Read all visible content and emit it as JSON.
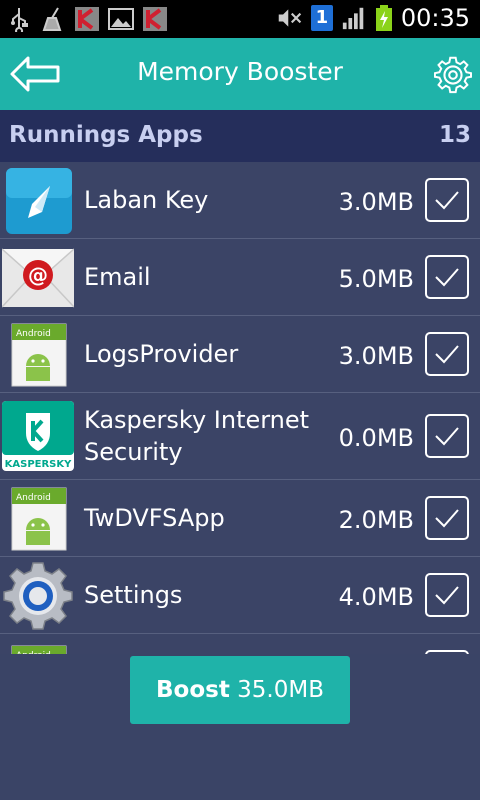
{
  "status_bar": {
    "time": "00:35",
    "sim_badge": "1",
    "icons": [
      "usb-icon",
      "cleaner-icon",
      "kaspersky-icon",
      "image-icon",
      "kaspersky-icon",
      "mute-icon",
      "sim-icon",
      "signal-icon",
      "battery-charging-icon"
    ]
  },
  "app_bar": {
    "title": "Memory Booster",
    "back_icon": "back-arrow-icon",
    "settings_icon": "gear-icon"
  },
  "section": {
    "label": "Runnings Apps",
    "count": "13"
  },
  "apps": [
    {
      "name": "Laban Key",
      "size": "3.0MB",
      "icon": "laban-key-icon",
      "checked": true
    },
    {
      "name": "Email",
      "size": "5.0MB",
      "icon": "email-icon",
      "checked": true
    },
    {
      "name": "LogsProvider",
      "size": "3.0MB",
      "icon": "android-app-icon",
      "checked": true
    },
    {
      "name": "Kaspersky Internet Security",
      "size": "0.0MB",
      "icon": "kaspersky-app-icon",
      "checked": true
    },
    {
      "name": "TwDVFSApp",
      "size": "2.0MB",
      "icon": "android-app-icon",
      "checked": true
    },
    {
      "name": "Settings",
      "size": "4.0MB",
      "icon": "settings-app-icon",
      "checked": true
    }
  ],
  "boost_button": {
    "label": "Boost",
    "amount": "35.0MB"
  },
  "colors": {
    "accent": "#1fb3a9",
    "header": "#252e5b",
    "background": "#3a4466"
  }
}
